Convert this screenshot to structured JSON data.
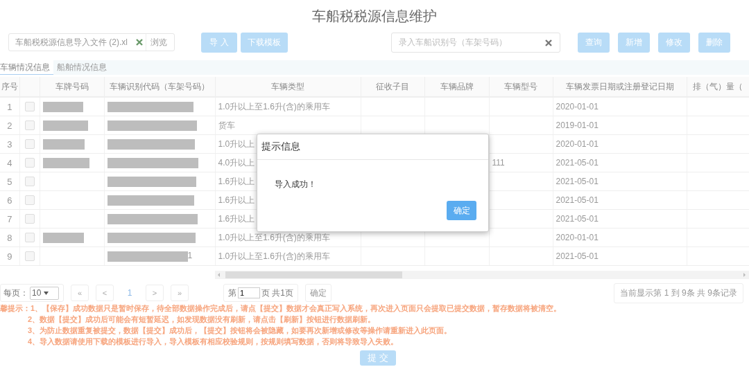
{
  "title": "车船税税源信息维护",
  "file_field": {
    "value": "车船税税源信息导入文件 (2).xl",
    "browse": "浏览"
  },
  "import_buttons": [
    "导 入",
    "下载模板"
  ],
  "search": {
    "placeholder": "录入车船识别号（车架号码）"
  },
  "action_buttons": [
    "查询",
    "新增",
    "修改",
    "删除"
  ],
  "tabs": [
    {
      "label": "车辆情况信息",
      "selected": true
    },
    {
      "label": "船舶情况信息",
      "selected": false
    }
  ],
  "table": {
    "columns": [
      "序号",
      "",
      "车牌号码",
      "车辆识别代码（车架号码）",
      "车辆类型",
      "征收子目",
      "车辆品牌",
      "车辆型号",
      "车辆发票日期或注册登记日期",
      "排（气）量（"
    ],
    "rows": [
      {
        "seq": "1",
        "checked": false,
        "plate_redacted": true,
        "vin_redacted": true,
        "type": "1.0升以上至1.6升(含)的乘用车",
        "model": "",
        "date": "2020-01-01"
      },
      {
        "seq": "2",
        "checked": false,
        "plate_redacted": true,
        "vin_redacted": true,
        "type": "货车",
        "model": "",
        "date": "2019-01-01"
      },
      {
        "seq": "3",
        "checked": false,
        "plate_redacted": true,
        "vin_redacted": true,
        "type": "1.0升以上",
        "model": "",
        "date": "2020-01-01"
      },
      {
        "seq": "4",
        "checked": false,
        "plate_redacted": true,
        "vin_redacted": true,
        "type": "4.0升以上",
        "model": "111",
        "date": "2021-05-01"
      },
      {
        "seq": "5",
        "checked": false,
        "plate_redacted": false,
        "vin_redacted": true,
        "type": "1.6升以上",
        "model": "",
        "date": "2021-05-01"
      },
      {
        "seq": "6",
        "checked": false,
        "plate_redacted": false,
        "vin_redacted": true,
        "type": "1.6升以上",
        "model": "",
        "date": "2021-05-01"
      },
      {
        "seq": "7",
        "checked": false,
        "plate_redacted": false,
        "vin_redacted": true,
        "type": "1.6升以上",
        "model": "",
        "date": "2021-05-01"
      },
      {
        "seq": "8",
        "checked": false,
        "plate_redacted": true,
        "vin_redacted": true,
        "type": "1.0升以上至1.6升(含)的乘用车",
        "model": "",
        "date": "2020-01-01"
      },
      {
        "seq": "9",
        "checked": false,
        "plate_redacted": false,
        "vin_redacted": true,
        "vin_suffix": "1",
        "type": "1.0升以上至1.6升(含)的乘用车",
        "model": "",
        "date": "2021-05-01"
      }
    ]
  },
  "pagination": {
    "per_page_label": "每页：",
    "per_page": "10",
    "pages": [
      {
        "label": "«",
        "selected": false
      },
      {
        "label": "<",
        "selected": false
      },
      {
        "label": "1",
        "selected": true
      },
      {
        "label": ">",
        "selected": false
      },
      {
        "label": "»",
        "selected": false
      }
    ],
    "page_prefix": "第",
    "page_input": "1",
    "page_suffix": "页 共1页",
    "go": "确定",
    "summary": "当前显示第 1 到 9条 共 9条记录"
  },
  "notes": {
    "label": "馨提示：",
    "items": [
      "1、【保存】成功数据只是暂时保存，待全部数据操作完成后，请点【提交】数据才会真正写入系统，再次进入页面只会提取已提交数据，暂存数据将被清空。",
      "2、数据【提交】成功后可能会有短暂延迟，如发现数据没有刷新，请点击【刷新】按钮进行数据刷新。",
      "3、为防止数据重复被提交，数据【提交】成功后，【提交】按钮将会被隐藏，如要再次新增或修改等操作请重新进入此页面。",
      "4、导入数据请使用下载的模板进行导入，导入模板有相应校验规则，按规则填写数据，否则将导致导入失败。"
    ]
  },
  "submit": "提 交",
  "dialog": {
    "title": "提示信息",
    "message": "导入成功！",
    "button": "确定"
  }
}
